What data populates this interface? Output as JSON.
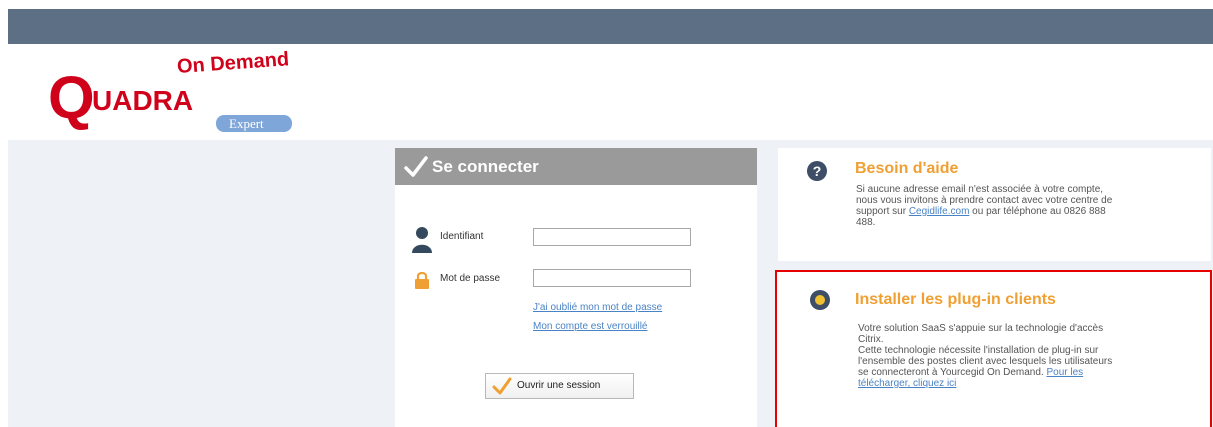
{
  "logo": {
    "tagline": "On Demand",
    "brand_initial": "Q",
    "brand_rest": "UADRA",
    "edition": "Expert"
  },
  "login": {
    "title": "Se connecter",
    "identifiant_label": "Identifiant",
    "identifiant_value": "",
    "password_label": "Mot de passe",
    "password_value": "",
    "forgot_password_link": "J'ai oublié mon mot de passe",
    "locked_account_link": "Mon compte est verrouillé",
    "submit_label": "Ouvrir une session"
  },
  "help": {
    "title": "Besoin d'aide",
    "text_lines": [
      "Si aucune adresse email n'est associée à votre compte,",
      "nous vous invitons à prendre contact avec votre centre de",
      "support sur"
    ],
    "link_text": "Cegidlife.com",
    "text_after_link": " ou par téléphone au 0826 888",
    "text_last_line": "488."
  },
  "plugin": {
    "title": "Installer les plug-in clients",
    "line1": "Votre solution SaaS s'appuie sur la technologie d'accès",
    "line2": "Citrix.",
    "line3": "Cette technologie nécessite l'installation de plug-in sur",
    "line4": "l'ensemble des postes client avec lesquels les utilisateurs",
    "line5": "se connecteront à Yourcegid On Demand.",
    "link_part1": "Pour les",
    "link_part2": "télécharger, cliquez ici"
  },
  "colors": {
    "topbar": "#5d6f85",
    "accent_orange": "#f0a033",
    "brand_red": "#d0021b",
    "link_blue": "#4a83c4",
    "highlight_red": "#e60000"
  }
}
